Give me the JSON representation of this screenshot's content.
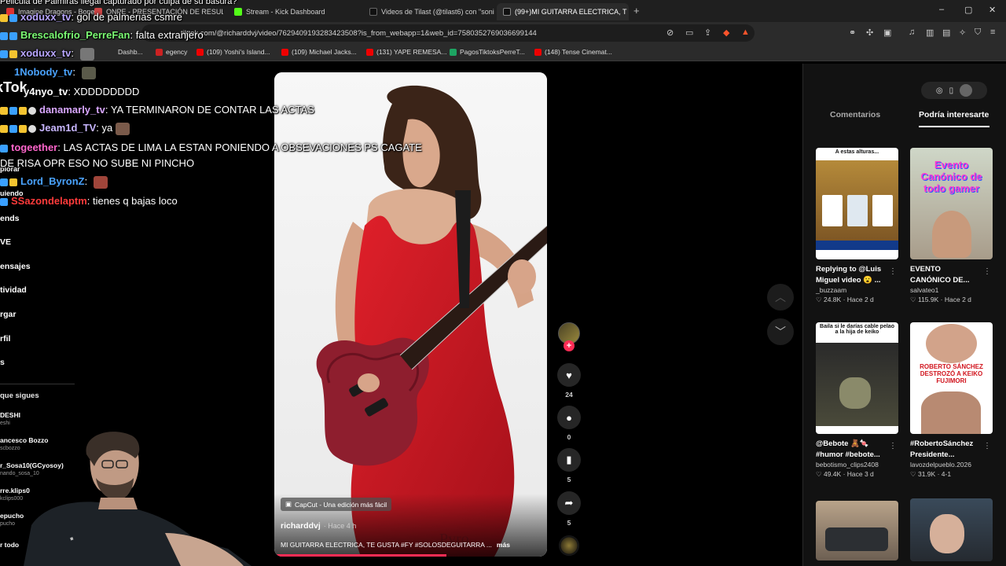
{
  "browser": {
    "tabs": [
      {
        "label": "Imagine Dragons - Bones (Offi",
        "fav": "#d33"
      },
      {
        "label": "ONPE - PRESENTACIÓN DE RESULTA",
        "fav": "#c44"
      },
      {
        "label": "Stream - Kick Dashboard",
        "fav": "#53fc18"
      },
      {
        "label": "Videos de Tilast (@tilast6) con \"soni",
        "fav": "#111"
      },
      {
        "label": "(99+)MI GUITARRA ELECTRICA, T",
        "fav": "#111",
        "active": true
      }
    ],
    "tab_close": "×",
    "new_tab": "+",
    "window_controls": [
      "–",
      "▢",
      "✕"
    ],
    "url": "tiktok.com/@richarddvj/video/7629409193283423508?is_from_webapp=1&web_id=7580352769036699144",
    "bookmarks": [
      {
        "label": "Dashb...",
        "color": "#888"
      },
      {
        "label": "egency",
        "color": "#c22"
      },
      {
        "label": "(109) Yoshi's Island...",
        "color": "#e00"
      },
      {
        "label": "(109) Michael Jacks...",
        "color": "#e00"
      },
      {
        "label": "(131) YAPE REMESA...",
        "color": "#e00"
      },
      {
        "label": "PagosTiktoksPerreT...",
        "color": "#1da462"
      },
      {
        "label": "(148) Tense Cinemat...",
        "color": "#e00"
      }
    ]
  },
  "sidebar": {
    "logo": "kTok",
    "items": [
      "plorar",
      "uiendo",
      "ends",
      "VE",
      "ensajes",
      "tividad",
      "rgar",
      "rfil",
      "s"
    ],
    "following_title": "que sigues",
    "following": [
      {
        "name": "DESHI",
        "handle": "eshi"
      },
      {
        "name": "ancesco Bozzo",
        "handle": "scbozzo"
      },
      {
        "name": "r_Sosa10(GCyosoy)",
        "handle": "nando_sosa_10"
      },
      {
        "name": "rre.klips0",
        "handle": "kclips000"
      },
      {
        "name": "epucho",
        "handle": "pucho"
      },
      {
        "name": "r todo",
        "handle": ""
      }
    ]
  },
  "video": {
    "watermark": "CapCut - Una edición más fácil",
    "author": "richarddvj",
    "time": "· Hace 4 h",
    "caption": "MI GUITARRA ELECTRICA, TE GUSTA #FY #SOLOSDEGUITARRA ...",
    "more": "más",
    "progress": 0.63
  },
  "actions": {
    "follow": "+",
    "like_icon": "heart-icon",
    "likes": "24",
    "comments": "0",
    "saves": "5",
    "shares": "5"
  },
  "right_panel": {
    "tabs": [
      "Comentarios",
      "Podría interesarte"
    ],
    "cards": [
      {
        "title": "Replying to @Luis\nMiguel video 😮 ...",
        "user": "_buzzaam",
        "likes": "24.8K",
        "time": "Hace 2 d",
        "overlay": "A estas alturas..."
      },
      {
        "title": "EVENTO\nCANÓNICO DE...",
        "user": "salvateo1",
        "likes": "115.9K",
        "time": "Hace 2 d",
        "overlay": "Evento Canónico de todo gamer"
      },
      {
        "title": "@Bebote 🧸🍬\n#humor #bebote...",
        "user": "bebotismo_clips2408",
        "likes": "49.4K",
        "time": "Hace 3 d",
        "overlay": "Baila si le darías cable pelao a la hija de keiko"
      },
      {
        "title": "#RobertoSánchez\nPresidente...",
        "user": "lavozdelpueblo.2026",
        "likes": "31.9K",
        "time": "4-1",
        "overlay": "ROBERTO SÁNCHEZ DESTROZÓ A KEIKO FUJIMORI"
      }
    ]
  },
  "chat": [
    {
      "user": "xoduxx_tv",
      "color": "#b8a6ff",
      "msg": "gol de palmerias csmre"
    },
    {
      "user": "Brescalofrio_PerreFan",
      "color": "#7cfc74",
      "msg": "falta extranjero"
    },
    {
      "user": "xoduxx_tv",
      "color": "#b8a6ff",
      "msg": ""
    },
    {
      "user": "1Nobody_tv",
      "color": "#4aa3ff",
      "msg": ""
    },
    {
      "user": "y4nyo_tv",
      "color": "#ffffff",
      "msg": "XDDDDDDDD"
    },
    {
      "user": "danamarly_tv",
      "color": "#d9a7ff",
      "msg": "YA TERMINARON DE CONTAR LAS ACTAS"
    },
    {
      "user": "Jeam1d_TV",
      "color": "#c8b6ff",
      "msg": "ya"
    },
    {
      "user": "togeether",
      "color": "#ff66cc",
      "msg": "LAS ACTAS DE LIMA LA ESTAN PONIENDO A OBSEVACIONES PS CAGATE"
    },
    {
      "user": "",
      "color": "#ffffff",
      "msg": "DE RISA OPR ESO NO SUBE NI PINCHO"
    },
    {
      "user": "Lord_ByronZ",
      "color": "#4aa3ff",
      "msg": ""
    },
    {
      "user": "SSazondelaptm",
      "color": "#ff3b3b",
      "msg": "tienes q bajas loco"
    }
  ]
}
